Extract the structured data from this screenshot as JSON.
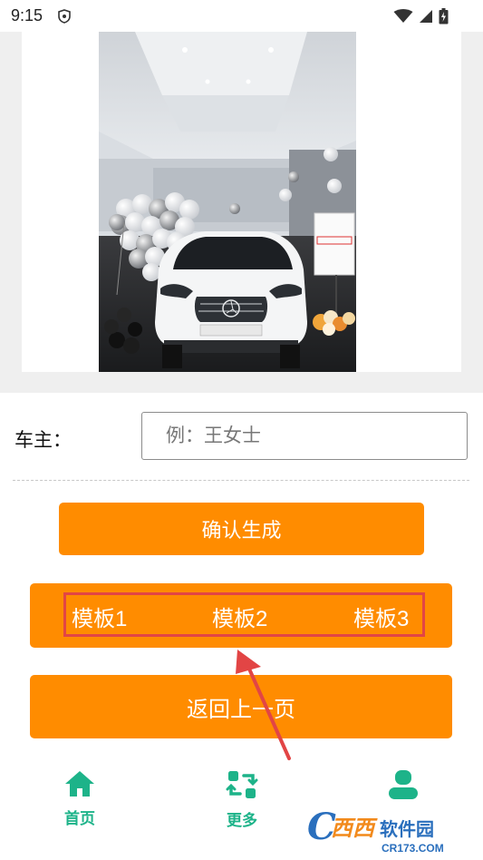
{
  "status_bar": {
    "time": "9:15"
  },
  "form": {
    "owner_label": "车主：",
    "owner_placeholder": "例：王女士",
    "owner_value": ""
  },
  "buttons": {
    "confirm": "确认生成",
    "template1": "模板1",
    "template2": "模板2",
    "template3": "模板3",
    "back": "返回上一页"
  },
  "nav": {
    "home": "首页",
    "more": "更多"
  },
  "watermark": {
    "brand": "西西软件园",
    "url": "CR173.COM"
  },
  "colors": {
    "accent": "#ff8c00",
    "nav_green": "#1db389",
    "highlight_red": "#e24545"
  },
  "icons": [
    "shield-icon",
    "wifi-icon",
    "signal-icon",
    "battery-icon",
    "home-icon",
    "refresh-icon",
    "user-icon"
  ]
}
